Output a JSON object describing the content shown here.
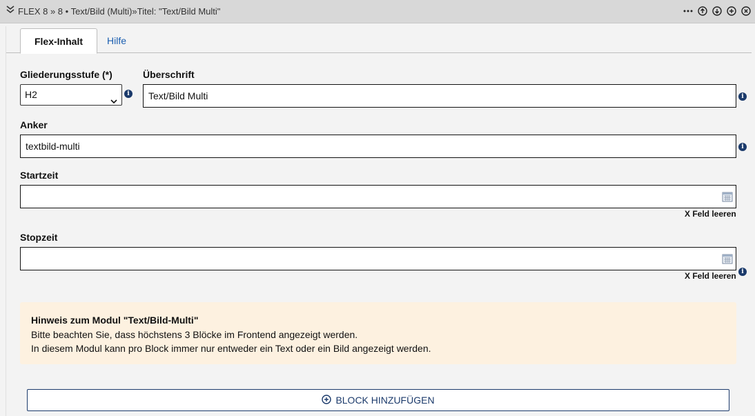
{
  "header": {
    "title": "FLEX 8 »  8 • Text/Bild (Multi)»Titel: \"Text/Bild Multi\"",
    "actions": [
      "more-icon",
      "arrow-up-icon",
      "arrow-down-icon",
      "add-icon",
      "close-icon"
    ]
  },
  "tabs": [
    {
      "label": "Flex-Inhalt",
      "active": true
    },
    {
      "label": "Hilfe",
      "active": false
    }
  ],
  "form": {
    "level": {
      "label": "Gliederungsstufe (*)",
      "value": "H2"
    },
    "heading": {
      "label": "Überschrift",
      "value": "Text/Bild Multi"
    },
    "anchor": {
      "label": "Anker",
      "value": "textbild-multi"
    },
    "start": {
      "label": "Startzeit",
      "value": "",
      "clear_label": "X Feld leeren"
    },
    "stop": {
      "label": "Stopzeit",
      "value": "",
      "clear_label": "X Feld leeren"
    }
  },
  "notice": {
    "title": "Hinweis zum Modul \"Text/Bild-Multi\"",
    "lines": [
      "Bitte beachten Sie, dass höchstens 3 Blöcke im Frontend angezeigt werden.",
      "In diesem Modul kann pro Block immer nur entweder ein Text oder ein Bild angezeigt werden."
    ]
  },
  "add_block": {
    "label": "BLOCK HINZUFÜGEN"
  },
  "colors": {
    "accent": "#1b3a6b",
    "link": "#1a5eb0",
    "notice_bg": "#fdf1e0",
    "header_bg": "#d8d8d8"
  }
}
